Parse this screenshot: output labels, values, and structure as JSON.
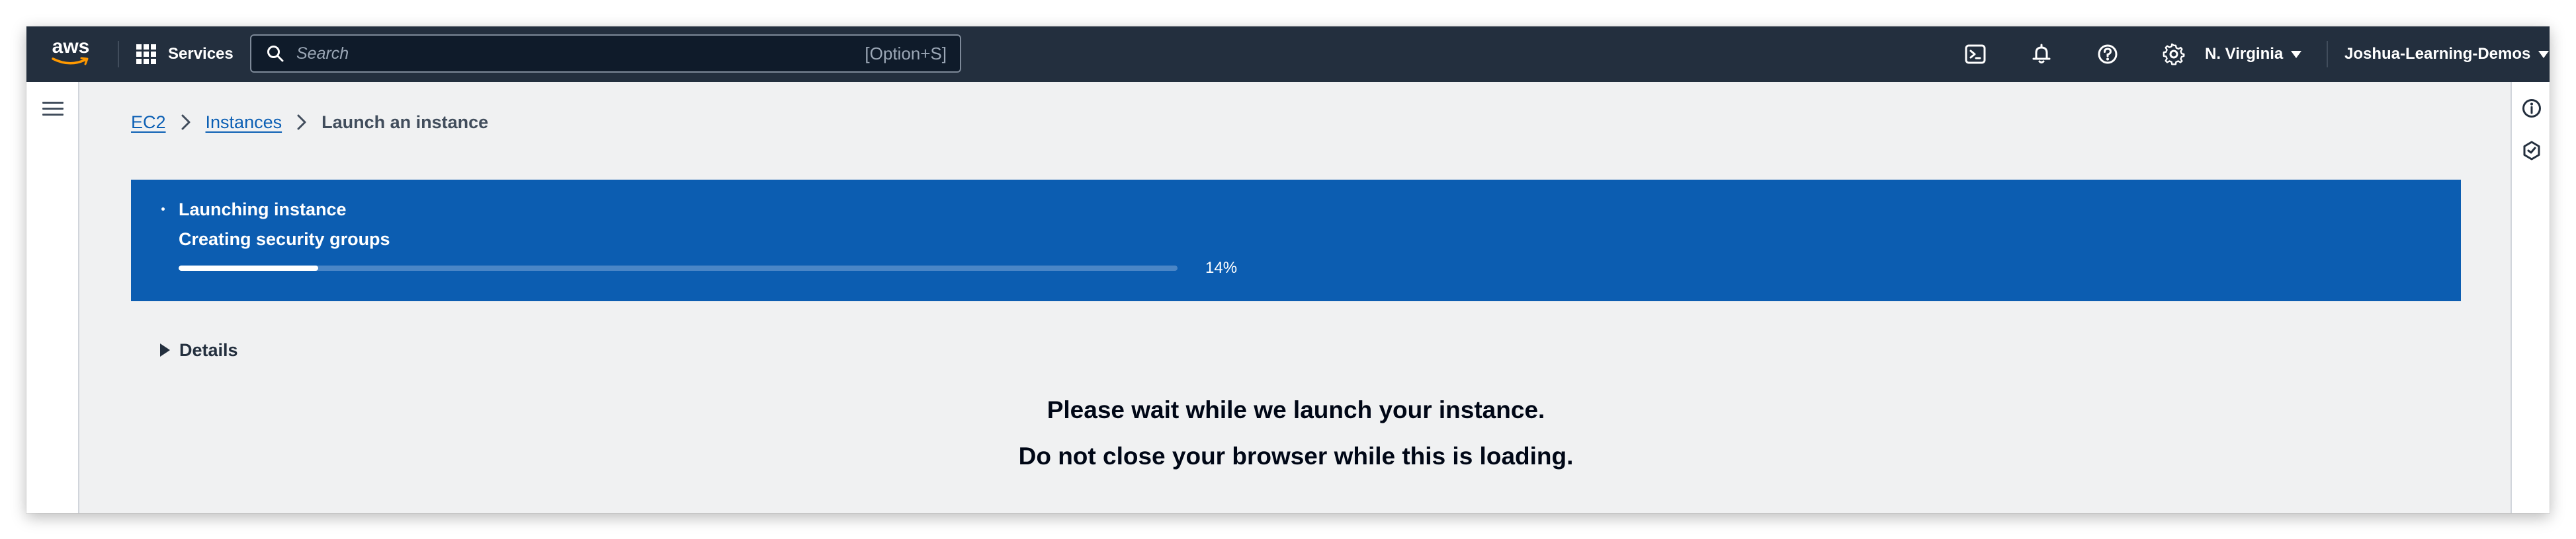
{
  "nav": {
    "logo_text": "aws",
    "services_label": "Services",
    "search_placeholder": "Search",
    "search_shortcut": "[Option+S]",
    "region": "N. Virginia",
    "account": "Joshua-Learning-Demos",
    "icons": [
      "cloudshell-icon",
      "bell-icon",
      "help-icon",
      "gear-icon"
    ]
  },
  "breadcrumb": {
    "items": [
      "EC2",
      "Instances"
    ],
    "current": "Launch an instance"
  },
  "flash": {
    "title": "Launching instance",
    "subtitle": "Creating security groups",
    "progress_percent": 14,
    "progress_label": "14%",
    "background_color": "#0c5db1"
  },
  "details": {
    "label": "Details"
  },
  "messages": {
    "line1": "Please wait while we launch your instance.",
    "line2": "Do not close your browser while this is loading."
  },
  "colors": {
    "nav_bg": "#232f3e",
    "link": "#0b5fb4",
    "page_bg": "#f0f1f2"
  }
}
